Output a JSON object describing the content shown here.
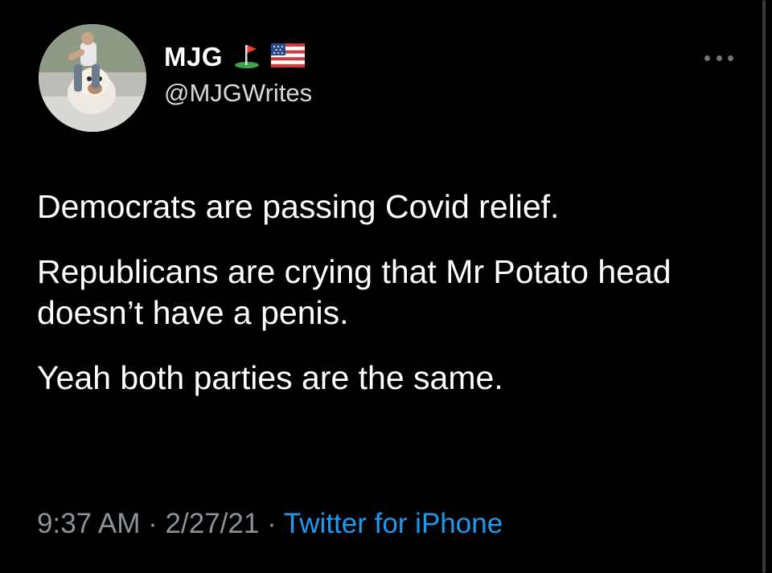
{
  "user": {
    "display_name": "MJG",
    "handle": "@MJGWrites",
    "emoji": [
      "golf-flag-emoji",
      "us-flag-emoji"
    ]
  },
  "tweet": {
    "paragraphs": [
      "Democrats are passing Covid relief.",
      "Republicans are crying that Mr Potato head doesn’t have a penis.",
      "Yeah both parties are the same."
    ],
    "time": "9:37 AM",
    "separator": "·",
    "date": "2/27/21",
    "source": "Twitter for iPhone"
  },
  "colors": {
    "background": "#000000",
    "text": "#ffffff",
    "secondary": "#8b9299",
    "link": "#1d9bf0"
  }
}
